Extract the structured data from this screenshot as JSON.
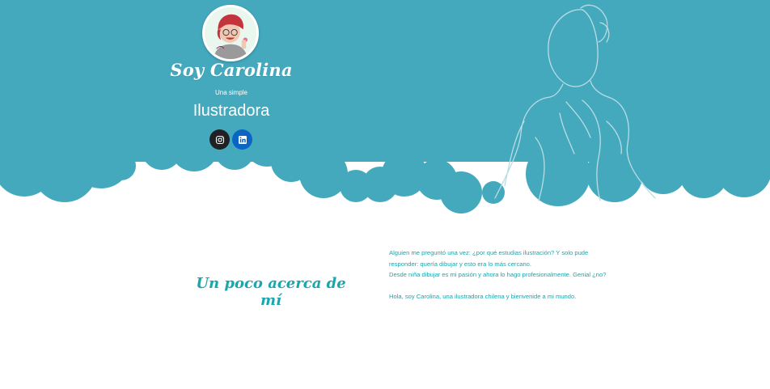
{
  "header": {
    "site_title": "Soy Carolina",
    "tagline": "Una simple",
    "role": "Ilustradora",
    "avatar_icon": "illustrated-portrait",
    "social": [
      {
        "icon": "instagram-icon",
        "color": "#1f2124"
      },
      {
        "icon": "linkedin-icon",
        "color": "#0a66c2"
      }
    ]
  },
  "about": {
    "title": "Un poco acerca de mí",
    "paragraphs": [
      "Alguien me preguntó una vez: ¿por qué estudias ilustración? Y solo pude",
      "responder: quería dibujar y esto era lo más cercano.",
      "Desde niña dibujar es mi pasión y ahora lo hago profesionalmente. Genial ¿no?",
      "Hola, soy Carolina, una ilustradora chilena y bienvenide a mi mundo."
    ]
  },
  "colors": {
    "hero": "#45a9bd",
    "accent_text": "#1aa6ad",
    "sketch": "#b7dde5"
  }
}
